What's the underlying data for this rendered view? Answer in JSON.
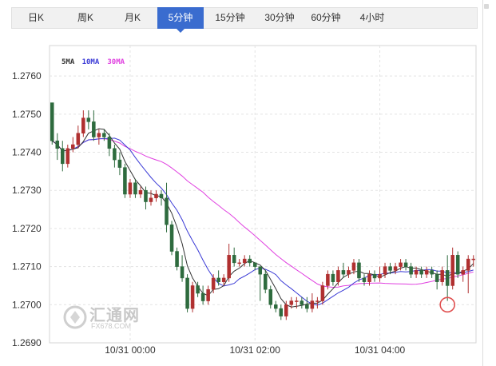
{
  "tabs": [
    {
      "label": "日K",
      "active": false
    },
    {
      "label": "周K",
      "active": false
    },
    {
      "label": "月K",
      "active": false
    },
    {
      "label": "5分钟",
      "active": true
    },
    {
      "label": "15分钟",
      "active": false
    },
    {
      "label": "30分钟",
      "active": false
    },
    {
      "label": "60分钟",
      "active": false
    },
    {
      "label": "4小时",
      "active": false
    }
  ],
  "watermark": {
    "text_cn": "汇通网",
    "text_en": "FX678.COM"
  },
  "colors": {
    "up": "#b03030",
    "down": "#2e6b3e",
    "ma5": "#333333",
    "ma10": "#3b3bd6",
    "ma30": "#e040e0",
    "grid": "#e3e3e3",
    "accent": "#3a6ccf",
    "marker": "#e05050"
  },
  "chart_data": {
    "type": "candlestick",
    "title": "",
    "ylim": [
      1.269,
      1.2768
    ],
    "yticks": [
      "1.2690",
      "1.2700",
      "1.2710",
      "1.2720",
      "1.2730",
      "1.2740",
      "1.2750",
      "1.2760"
    ],
    "xticks": [
      {
        "label": "10/31 00:00",
        "index": 15
      },
      {
        "label": "10/31 02:00",
        "index": 39
      },
      {
        "label": "10/31 04:00",
        "index": 63
      }
    ],
    "legend": [
      {
        "name": "5MA",
        "color": "#333333"
      },
      {
        "name": "10MA",
        "color": "#3b3bd6"
      },
      {
        "name": "30MA",
        "color": "#e040e0"
      }
    ],
    "marker": {
      "index": 76,
      "price": 1.27
    },
    "candles": [
      [
        1.2753,
        1.2743,
        1.2753,
        1.2742
      ],
      [
        1.2743,
        1.2741,
        1.2745,
        1.2738
      ],
      [
        1.2741,
        1.2737,
        1.2743,
        1.2735
      ],
      [
        1.2737,
        1.2741,
        1.2742,
        1.2736
      ],
      [
        1.2741,
        1.2742,
        1.2744,
        1.274
      ],
      [
        1.2742,
        1.2745,
        1.2747,
        1.2741
      ],
      [
        1.2745,
        1.2749,
        1.2751,
        1.2744
      ],
      [
        1.2749,
        1.2748,
        1.2751,
        1.2746
      ],
      [
        1.2748,
        1.2744,
        1.2751,
        1.2743
      ],
      [
        1.2744,
        1.2745,
        1.2746,
        1.2742
      ],
      [
        1.2745,
        1.2744,
        1.2746,
        1.2743
      ],
      [
        1.2744,
        1.2741,
        1.2745,
        1.2739
      ],
      [
        1.2741,
        1.2738,
        1.2742,
        1.2736
      ],
      [
        1.2738,
        1.2736,
        1.274,
        1.2734
      ],
      [
        1.2736,
        1.2729,
        1.2737,
        1.2728
      ],
      [
        1.2729,
        1.2732,
        1.2733,
        1.2728
      ],
      [
        1.2732,
        1.2729,
        1.2733,
        1.2728
      ],
      [
        1.2729,
        1.273,
        1.2731,
        1.2728
      ],
      [
        1.273,
        1.2727,
        1.2731,
        1.2725
      ],
      [
        1.2727,
        1.2728,
        1.273,
        1.2726
      ],
      [
        1.2728,
        1.2729,
        1.273,
        1.2727
      ],
      [
        1.2729,
        1.2728,
        1.273,
        1.2726
      ],
      [
        1.2728,
        1.2721,
        1.2732,
        1.2719
      ],
      [
        1.2721,
        1.2714,
        1.2722,
        1.2713
      ],
      [
        1.2714,
        1.271,
        1.2715,
        1.2709
      ],
      [
        1.271,
        1.2707,
        1.2713,
        1.2706
      ],
      [
        1.2707,
        1.2699,
        1.2708,
        1.2698
      ],
      [
        1.2699,
        1.2705,
        1.2706,
        1.2698
      ],
      [
        1.2705,
        1.2703,
        1.2706,
        1.2702
      ],
      [
        1.2703,
        1.2701,
        1.2705,
        1.27
      ],
      [
        1.2701,
        1.2704,
        1.2705,
        1.27
      ],
      [
        1.2704,
        1.2707,
        1.2708,
        1.2703
      ],
      [
        1.2707,
        1.2706,
        1.2709,
        1.2705
      ],
      [
        1.2706,
        1.2707,
        1.2708,
        1.2705
      ],
      [
        1.2707,
        1.2713,
        1.2716,
        1.2706
      ],
      [
        1.2713,
        1.2711,
        1.2715,
        1.271
      ],
      [
        1.2711,
        1.2711,
        1.2712,
        1.271
      ],
      [
        1.2711,
        1.2712,
        1.2713,
        1.271
      ],
      [
        1.2712,
        1.2711,
        1.2713,
        1.271
      ],
      [
        1.2711,
        1.271,
        1.2711,
        1.2709
      ],
      [
        1.271,
        1.2708,
        1.271,
        1.2701
      ],
      [
        1.2708,
        1.2704,
        1.2709,
        1.2703
      ],
      [
        1.2704,
        1.27,
        1.2705,
        1.2699
      ],
      [
        1.27,
        1.2699,
        1.2701,
        1.2698
      ],
      [
        1.2699,
        1.2697,
        1.27,
        1.2696
      ],
      [
        1.2697,
        1.27,
        1.2701,
        1.2696
      ],
      [
        1.27,
        1.2701,
        1.2702,
        1.2699
      ],
      [
        1.2701,
        1.2701,
        1.2702,
        1.2699
      ],
      [
        1.2701,
        1.27,
        1.2702,
        1.2699
      ],
      [
        1.27,
        1.2699,
        1.2702,
        1.2698
      ],
      [
        1.2699,
        1.2701,
        1.2703,
        1.2698
      ],
      [
        1.2701,
        1.2701,
        1.2702,
        1.2699
      ],
      [
        1.2701,
        1.2705,
        1.2706,
        1.27
      ],
      [
        1.2705,
        1.2708,
        1.2709,
        1.2704
      ],
      [
        1.2708,
        1.2706,
        1.2709,
        1.2705
      ],
      [
        1.2706,
        1.2709,
        1.271,
        1.2705
      ],
      [
        1.2709,
        1.2708,
        1.2711,
        1.2707
      ],
      [
        1.2708,
        1.2709,
        1.271,
        1.2707
      ],
      [
        1.2709,
        1.2711,
        1.2712,
        1.2708
      ],
      [
        1.2711,
        1.2707,
        1.2712,
        1.2706
      ],
      [
        1.2707,
        1.2706,
        1.2708,
        1.2705
      ],
      [
        1.2706,
        1.2708,
        1.2709,
        1.2705
      ],
      [
        1.2708,
        1.2707,
        1.2709,
        1.2706
      ],
      [
        1.2707,
        1.2708,
        1.271,
        1.2706
      ],
      [
        1.2708,
        1.271,
        1.2711,
        1.2707
      ],
      [
        1.271,
        1.2709,
        1.2711,
        1.2708
      ],
      [
        1.2709,
        1.271,
        1.2711,
        1.2708
      ],
      [
        1.271,
        1.2711,
        1.2712,
        1.2709
      ],
      [
        1.2711,
        1.271,
        1.2712,
        1.2709
      ],
      [
        1.271,
        1.2708,
        1.2711,
        1.2707
      ],
      [
        1.2708,
        1.2709,
        1.271,
        1.2707
      ],
      [
        1.2709,
        1.2708,
        1.271,
        1.2707
      ],
      [
        1.2708,
        1.2709,
        1.271,
        1.2707
      ],
      [
        1.2709,
        1.2708,
        1.271,
        1.2707
      ],
      [
        1.2708,
        1.2706,
        1.2709,
        1.2704
      ],
      [
        1.2706,
        1.2709,
        1.271,
        1.2705
      ],
      [
        1.2709,
        1.2705,
        1.2713,
        1.2701
      ],
      [
        1.2705,
        1.2713,
        1.2715,
        1.2704
      ],
      [
        1.2713,
        1.2708,
        1.2714,
        1.2707
      ],
      [
        1.2708,
        1.2709,
        1.271,
        1.2706
      ],
      [
        1.2709,
        1.2712,
        1.2713,
        1.2703
      ],
      [
        1.2712,
        1.2712,
        1.2713,
        1.271
      ]
    ]
  }
}
